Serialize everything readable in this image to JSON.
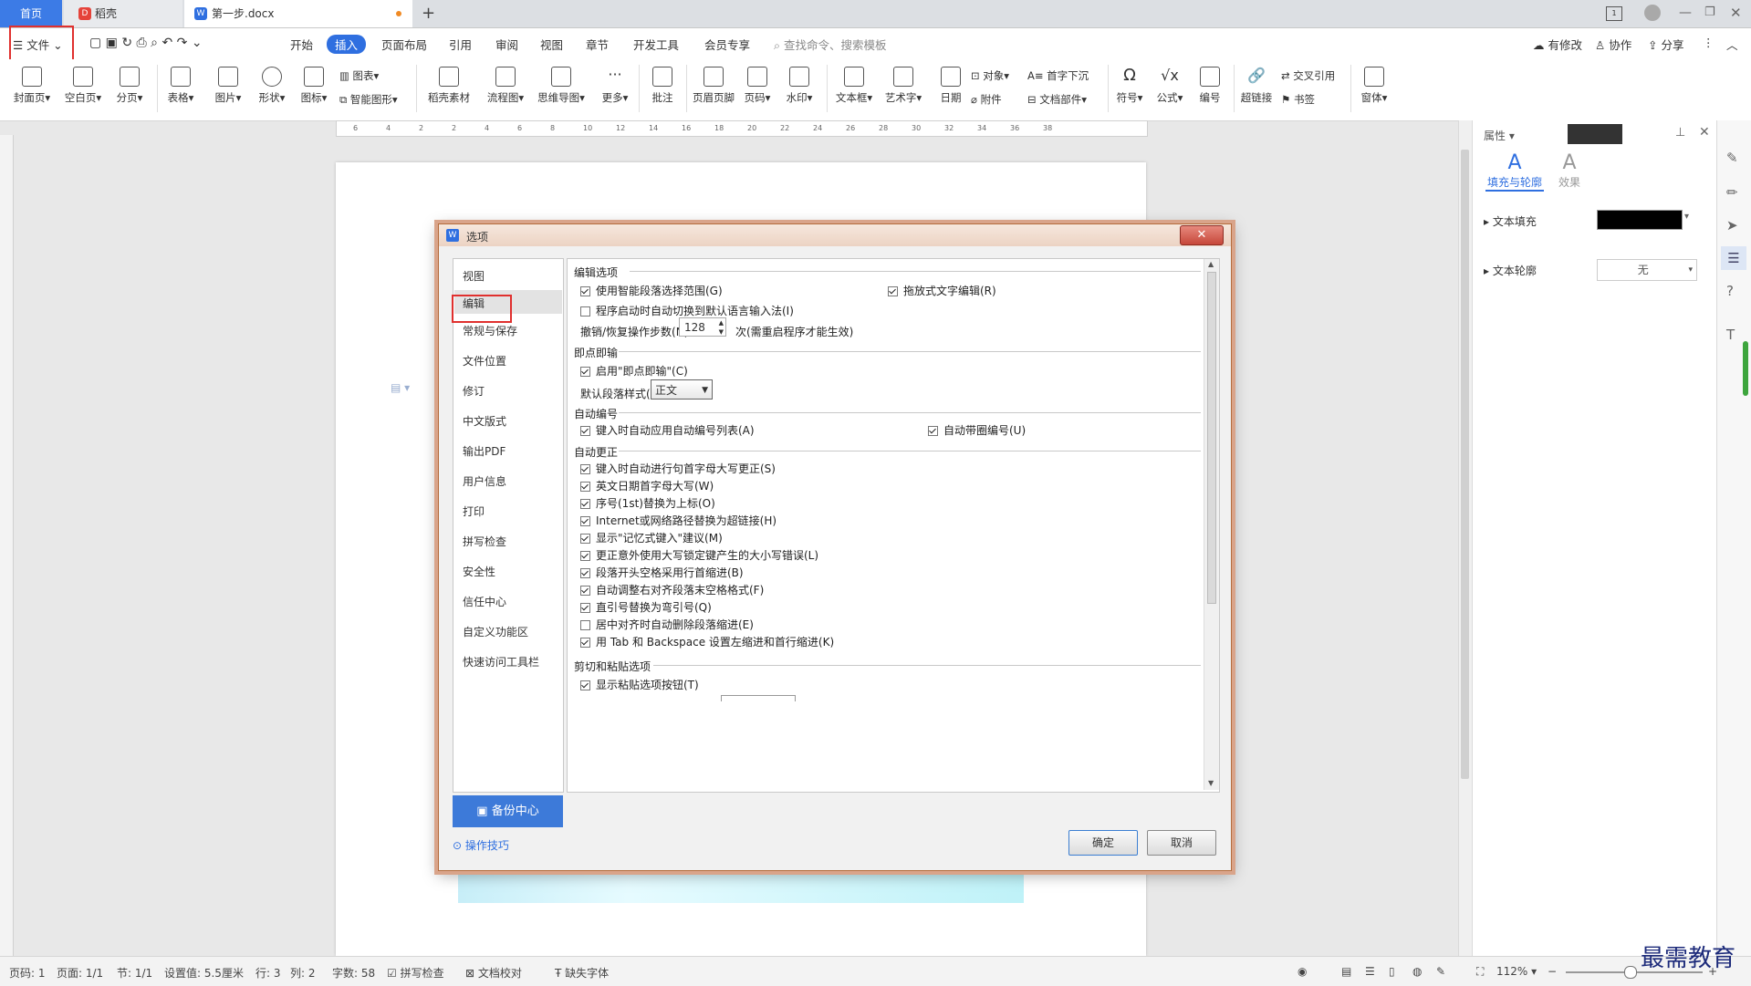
{
  "tabs": {
    "home": "首页",
    "daoke": "稻壳",
    "doc": "第一步.docx",
    "add": "+"
  },
  "menus": {
    "file": "文件",
    "start": "开始",
    "insert": "插入",
    "layout": "页面布局",
    "ref": "引用",
    "review": "审阅",
    "view": "视图",
    "chapter": "章节",
    "dev": "开发工具",
    "member": "会员专享",
    "search": "查找命令、搜索模板",
    "modified": "有修改",
    "collab": "协作",
    "share": "分享"
  },
  "ribbon": {
    "cover": "封面页",
    "blank": "空白页",
    "pagebreak": "分页",
    "table": "表格",
    "picture": "图片",
    "shape": "形状",
    "icon": "图标",
    "chart": "图表",
    "smartart": "智能图形",
    "shell": "稻壳素材",
    "flow": "流程图",
    "mind": "思维导图",
    "more": "更多",
    "comment": "批注",
    "header": "页眉页脚",
    "pagenum": "页码",
    "watermark": "水印",
    "textbox": "文本框",
    "wordart": "艺术字",
    "date": "日期",
    "object": "对象",
    "attach": "附件",
    "dropcap": "首字下沉",
    "docpart": "文档部件",
    "symbol": "符号",
    "formula": "公式",
    "number": "编号",
    "hyperlink": "超链接",
    "crossref": "交叉引用",
    "bookmark": "书签",
    "window": "窗体"
  },
  "ruler": [
    "6",
    "4",
    "2",
    "2",
    "4",
    "6",
    "8",
    "10",
    "12",
    "14",
    "16",
    "18",
    "20",
    "22",
    "24",
    "26",
    "28",
    "30",
    "32",
    "34",
    "36",
    "38"
  ],
  "props": {
    "title": "属性",
    "tab_fill": "填充与轮廓",
    "tab_effect": "效果",
    "text_fill": "文本填充",
    "text_outline": "文本轮廓",
    "outline_value": "无",
    "fill_color": "#000000"
  },
  "dialog": {
    "title": "选项",
    "nav": [
      "视图",
      "编辑",
      "常规与保存",
      "文件位置",
      "修订",
      "中文版式",
      "输出PDF",
      "用户信息",
      "打印",
      "拼写检查",
      "安全性",
      "信任中心",
      "自定义功能区",
      "快速访问工具栏"
    ],
    "backup": "备份中心",
    "tips": "操作技巧",
    "ok": "确定",
    "cancel": "取消",
    "sections": {
      "edit": "编辑选项",
      "click": "即点即输",
      "autonum": "自动编号",
      "autocorrect": "自动更正",
      "paste": "剪切和粘贴选项"
    },
    "edit_opts": {
      "smart_para": "使用智能段落选择范围(G)",
      "drag_edit": "拖放式文字编辑(R)",
      "auto_lang": "程序启动时自动切换到默认语言输入法(I)",
      "undo_label": "撤销/恢复操作步数(N):",
      "undo_value": "128",
      "undo_note": "次(需重启程序才能生效)"
    },
    "click_opts": {
      "enable": "启用\"即点即输\"(C)",
      "style_label": "默认段落样式(P):",
      "style_value": "正文"
    },
    "autonum_opts": {
      "apply_list": "键入时自动应用自动编号列表(A)",
      "circle_num": "自动带圈编号(U)"
    },
    "autocorrect_opts": [
      {
        "label": "键入时自动进行句首字母大写更正(S)",
        "checked": true
      },
      {
        "label": "英文日期首字母大写(W)",
        "checked": true
      },
      {
        "label": "序号(1st)替换为上标(O)",
        "checked": true
      },
      {
        "label": "Internet或网络路径替换为超链接(H)",
        "checked": true
      },
      {
        "label": "显示\"记忆式键入\"建议(M)",
        "checked": true
      },
      {
        "label": "更正意外使用大写锁定键产生的大小写错误(L)",
        "checked": true
      },
      {
        "label": "段落开头空格采用行首缩进(B)",
        "checked": true
      },
      {
        "label": "自动调整右对齐段落末空格格式(F)",
        "checked": true
      },
      {
        "label": "直引号替换为弯引号(Q)",
        "checked": true
      },
      {
        "label": "居中对齐时自动删除段落缩进(E)",
        "checked": false
      },
      {
        "label": "用 Tab 和 Backspace 设置左缩进和首行缩进(K)",
        "checked": true
      }
    ],
    "paste_opts": {
      "show_btn": "显示粘贴选项按钮(T)"
    }
  },
  "status": {
    "pagenum": "页码: 1",
    "page": "页面: 1/1",
    "section": "节: 1/1",
    "setting": "设置值: 5.5厘米",
    "row": "行: 3",
    "col": "列: 2",
    "words": "字数: 58",
    "spell": "拼写检查",
    "proof": "文档校对",
    "font": "缺失字体",
    "zoom": "112%"
  },
  "watermark_text": "最需教育"
}
